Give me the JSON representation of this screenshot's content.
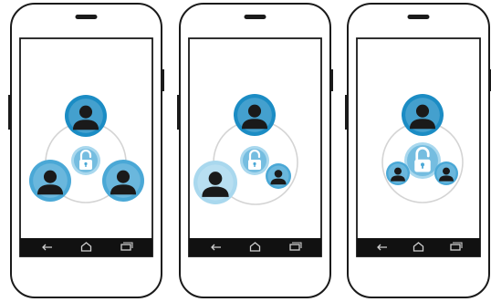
{
  "colors": {
    "phone_outline": "#1a1a1a",
    "screen_bg": "#ffffff",
    "nav_bar": "#111111",
    "nav_icon": "#cfcfcf",
    "ring": "#d4d4d4",
    "primary_blue": "#1b8cc4",
    "mid_blue": "#4aa8d6",
    "light_blue": "#a9d8ee",
    "person": "#1a1a1a",
    "lock": "#ffffff"
  },
  "phones": [
    {
      "name": "phone-1",
      "users": [
        {
          "role": "top-user",
          "size": "large",
          "shade": "primary_blue"
        },
        {
          "role": "left-user",
          "size": "large",
          "shade": "mid_blue"
        },
        {
          "role": "right-user",
          "size": "large",
          "shade": "mid_blue"
        }
      ]
    },
    {
      "name": "phone-2",
      "users": [
        {
          "role": "top-user",
          "size": "large",
          "shade": "primary_blue"
        },
        {
          "role": "left-user",
          "size": "large",
          "shade": "light_blue"
        },
        {
          "role": "right-user",
          "size": "small",
          "shade": "mid_blue"
        }
      ]
    },
    {
      "name": "phone-3",
      "users": [
        {
          "role": "top-user",
          "size": "large",
          "shade": "primary_blue"
        },
        {
          "role": "left-user",
          "size": "small",
          "shade": "mid_blue"
        },
        {
          "role": "right-user",
          "size": "small",
          "shade": "mid_blue"
        }
      ]
    }
  ],
  "icons": {
    "center": "padlock-unlocked-icon",
    "user": "person-icon",
    "nav": [
      "back-icon",
      "home-icon",
      "recent-apps-icon"
    ]
  }
}
